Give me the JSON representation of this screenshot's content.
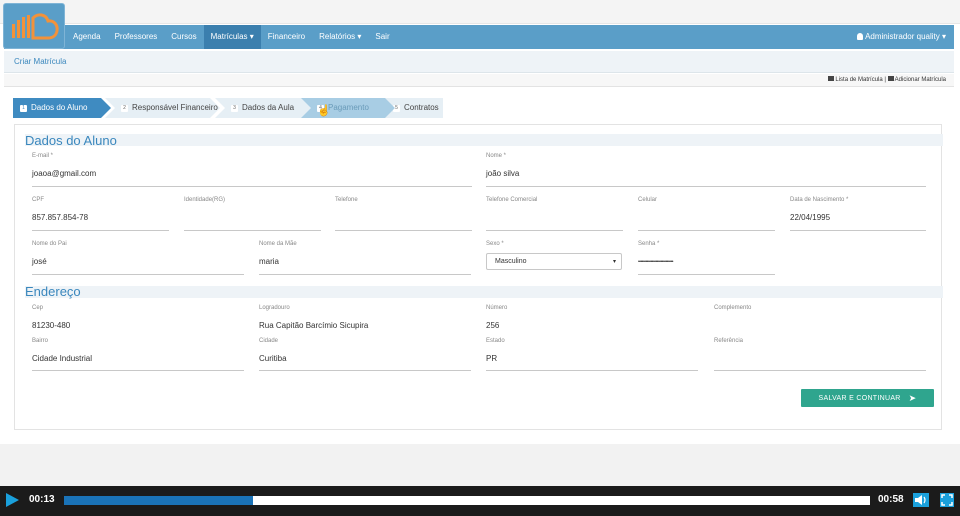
{
  "navbar": {
    "items": [
      {
        "label": "Agenda"
      },
      {
        "label": "Professores"
      },
      {
        "label": "Cursos"
      },
      {
        "label": "Matrículas ▾"
      },
      {
        "label": "Financeiro"
      },
      {
        "label": "Relatórios ▾"
      },
      {
        "label": "Sair"
      }
    ],
    "user_label": "Administrador quality ▾",
    "brand_color": "#5a9ec8",
    "logo_color": "#f2923a"
  },
  "breadcrumb": "Criar Matrícula",
  "toolbar": {
    "list_link": "Lista de Matrícula",
    "separator": "|",
    "add_link": "Adicionar Matrícula"
  },
  "wizard": {
    "steps": [
      {
        "num": "1",
        "label": "Dados do Aluno",
        "state": "active"
      },
      {
        "num": "2",
        "label": "Responsável Financeiro",
        "state": "pending"
      },
      {
        "num": "3",
        "label": "Dados da Aula",
        "state": "pending"
      },
      {
        "num": "4",
        "label": "Pagamento",
        "state": "hover"
      },
      {
        "num": "5",
        "label": "Contratos",
        "state": "pending"
      }
    ]
  },
  "student": {
    "title": "Dados do Aluno",
    "email": {
      "label": "E-mail *",
      "value": "joaoa@gmail.com"
    },
    "nome": {
      "label": "Nome *",
      "value": "joão silva"
    },
    "cpf": {
      "label": "CPF",
      "value": "857.857.854-78"
    },
    "rg": {
      "label": "Identidade(RG)",
      "value": ""
    },
    "telefone": {
      "label": "Telefone",
      "value": ""
    },
    "tel_comercial": {
      "label": "Telefone Comercial",
      "value": ""
    },
    "celular": {
      "label": "Celular",
      "value": ""
    },
    "nascimento": {
      "label": "Data de Nascimento *",
      "value": "22/04/1995"
    },
    "pai": {
      "label": "Nome do Pai",
      "value": "josé"
    },
    "mae": {
      "label": "Nome da Mãe",
      "value": "maria"
    },
    "sexo": {
      "label": "Sexo *",
      "value": "Masculino"
    },
    "senha": {
      "label": "Senha *",
      "value": "••••••••••••••••••••••••••••"
    }
  },
  "address": {
    "title": "Endereço",
    "cep": {
      "label": "Cep",
      "value": "81230-480"
    },
    "logradouro": {
      "label": "Logradouro",
      "value": "Rua Capitão Barcímio Sicupira"
    },
    "numero": {
      "label": "Número",
      "value": "256"
    },
    "complemento": {
      "label": "Complemento",
      "value": ""
    },
    "bairro": {
      "label": "Bairro",
      "value": "Cidade Industrial"
    },
    "cidade": {
      "label": "Cidade",
      "value": "Curitiba"
    },
    "estado": {
      "label": "Estado",
      "value": "PR"
    },
    "referencia": {
      "label": "Referência",
      "value": ""
    }
  },
  "save_button": {
    "label": "SALVAR E CONTINUAR",
    "color": "#2fa58e"
  },
  "player": {
    "current_time": "00:13",
    "total_time": "00:58",
    "progress": 0.235,
    "accent": "#1aa0dc"
  }
}
